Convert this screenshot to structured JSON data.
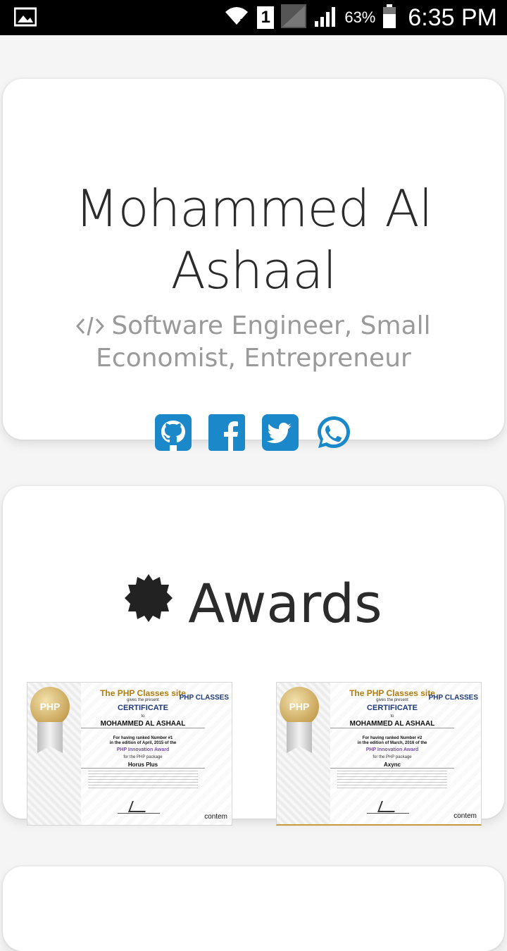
{
  "status_bar": {
    "battery_percent": "63%",
    "time": "6:35 PM",
    "sim_slot": "1",
    "icons": [
      "gallery-notification-icon",
      "wifi-icon",
      "sim-1-icon",
      "signal-weak-icon",
      "signal-icon",
      "battery-icon"
    ]
  },
  "profile": {
    "name_line1": "Mohammed Al",
    "name_line2": "Ashaal",
    "subtitle_line1": "Software Engineer, Small",
    "subtitle_line2": "Economist, Entrepreneur",
    "accent_color": "#1a88c9",
    "socials": [
      {
        "name": "github"
      },
      {
        "name": "facebook"
      },
      {
        "name": "twitter"
      },
      {
        "name": "whatsapp"
      }
    ]
  },
  "awards": {
    "title": "Awards",
    "certificates": [
      {
        "site": "The PHP Classes site",
        "gives": "gives the present",
        "heading": "CERTIFICATE",
        "to": "to",
        "recipient": "MOHAMMED AL ASHAAL",
        "rank_line1": "For having ranked Number #1",
        "rank_line2": "in the edition of April, 2015 of the",
        "award": "PHP Innovation Award",
        "for_package": "for the PHP package",
        "package": "Horus Plus",
        "seal": "PHP",
        "logo": "PHP CLASSES",
        "sponsor": "contem"
      },
      {
        "site": "The PHP Classes site",
        "gives": "gives the present",
        "heading": "CERTIFICATE",
        "to": "to",
        "recipient": "MOHAMMED AL ASHAAL",
        "rank_line1": "For having ranked Number #2",
        "rank_line2": "in the edition of March, 2016 of the",
        "award": "PHP Innovation Award",
        "for_package": "for the PHP package",
        "package": "Axync",
        "seal": "PHP",
        "logo": "PHP CLASSES",
        "sponsor": "contem"
      }
    ]
  }
}
